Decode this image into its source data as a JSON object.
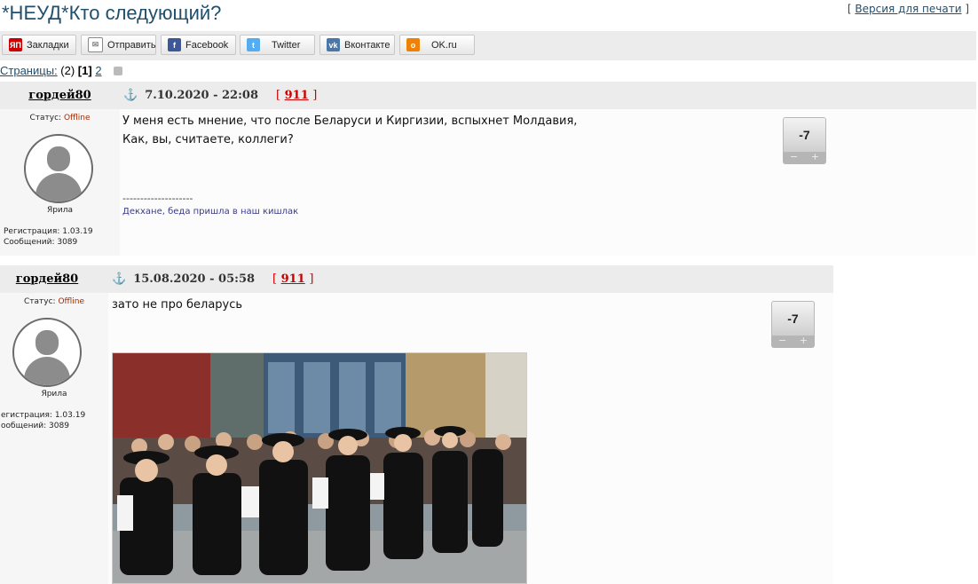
{
  "topic": {
    "title": "*НЕУД*Кто следующий?",
    "print_prefix": "[ ",
    "print_label": "Версия для печати",
    "print_suffix": " ]"
  },
  "share": [
    {
      "label": "Закладки",
      "icon": "yap-bookmarks-icon",
      "color": "#cc0000"
    },
    {
      "label": "Отправить",
      "icon": "mail-icon",
      "color": "#888888"
    },
    {
      "label": "Facebook",
      "icon": "facebook-icon",
      "color": "#3b5998"
    },
    {
      "label": "Twitter",
      "icon": "twitter-icon",
      "color": "#55acee"
    },
    {
      "label": "Вконтакте",
      "icon": "vk-icon",
      "color": "#4a76a8"
    },
    {
      "label": "OK.ru",
      "icon": "ok-icon",
      "color": "#ee8208"
    }
  ],
  "pages": {
    "label": "Страницы:",
    "count": "(2)",
    "current": "[1]",
    "next": "2"
  },
  "posts": [
    {
      "author": "гордей80",
      "status_label": "Статус:",
      "status": "Offline",
      "rank": "Ярила",
      "reg": "Регистрация: 1.03.19",
      "msgs": "Сообщений: 3089",
      "date": "7.10.2020 - 22:08",
      "num": "911",
      "lines": [
        "У меня есть мнение, что после Беларуси и Киргизии, вспыхнет Молдавия,",
        "Как, вы, считаете, коллеги?"
      ],
      "sig_sep": "--------------------",
      "sig": "Декхане, беда пришла в наш кишлак",
      "vote": "-7"
    },
    {
      "author": "гордей80",
      "status_label": "Статус:",
      "status": "Offline",
      "rank": "Ярила",
      "reg": "егистрация: 1.03.19",
      "msgs": "ообщений: 3089",
      "date": "15.08.2020 - 05:58",
      "num": "911",
      "lines": [
        "зато не про беларусь"
      ],
      "vote": "-7"
    }
  ],
  "vote_controls": {
    "minus": "−",
    "plus": "+"
  },
  "brackets": {
    "open": "[",
    "close": "]"
  }
}
